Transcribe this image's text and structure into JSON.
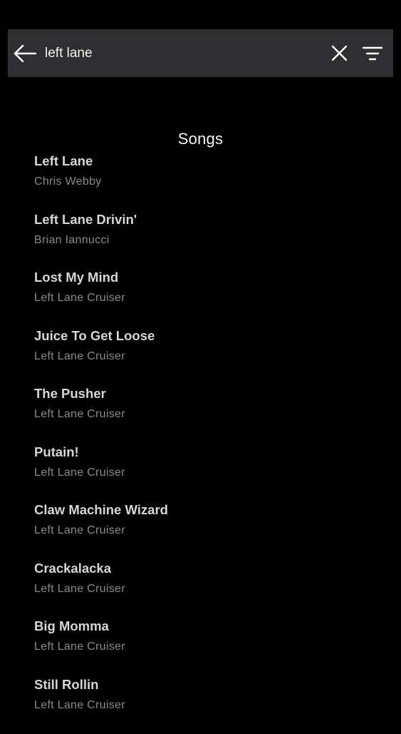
{
  "search": {
    "query": "left lane",
    "back_icon": "arrow-left-icon",
    "clear_icon": "close-icon",
    "filter_icon": "filter-icon"
  },
  "colors": {
    "background": "#000000",
    "search_bar": "#2f2f31",
    "title_text": "#d6d6d6",
    "artist_text": "#8a8a8a"
  },
  "section": {
    "title": "Songs"
  },
  "songs": [
    {
      "title": "Left Lane",
      "artist": "Chris Webby"
    },
    {
      "title": "Left Lane Drivin'",
      "artist": "Brian Iannucci"
    },
    {
      "title": "Lost My Mind",
      "artist": "Left Lane Cruiser"
    },
    {
      "title": "Juice To Get Loose",
      "artist": "Left Lane Cruiser"
    },
    {
      "title": "The Pusher",
      "artist": "Left Lane Cruiser"
    },
    {
      "title": "Putain!",
      "artist": "Left Lane Cruiser"
    },
    {
      "title": "Claw Machine Wizard",
      "artist": "Left Lane Cruiser"
    },
    {
      "title": "Crackalacka",
      "artist": "Left Lane Cruiser"
    },
    {
      "title": "Big Momma",
      "artist": "Left Lane Cruiser"
    },
    {
      "title": "Still Rollin",
      "artist": "Left Lane Cruiser"
    }
  ]
}
